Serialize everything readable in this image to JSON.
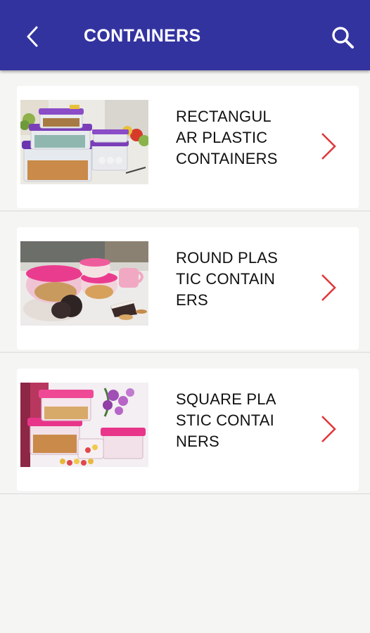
{
  "appbar": {
    "title": "CONTAINERS",
    "back_icon": "chevron-left-icon",
    "search_icon": "search-icon",
    "color": "#3333a0"
  },
  "items": [
    {
      "label": "RECTANGULAR PLASTIC CONTAINERS",
      "lid_color": "#7a3fb8"
    },
    {
      "label": "ROUND PLASTIC CONTAINERS",
      "lid_color": "#ea3c8e"
    },
    {
      "label": "SQUARE PLASTIC CONTAINERS",
      "lid_color": "#e8358a"
    }
  ],
  "chevron_color": "#e0393b"
}
